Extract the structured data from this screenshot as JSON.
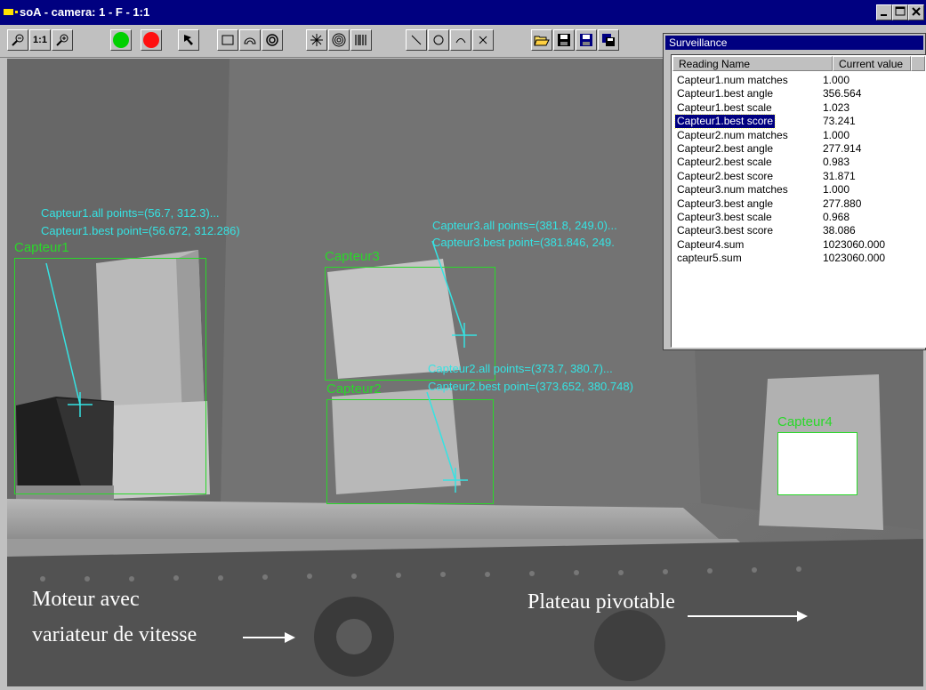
{
  "window": {
    "title": "soA - camera: 1 - F - 1:1",
    "controls": [
      "minimize-icon",
      "maximize-icon",
      "close-icon"
    ]
  },
  "toolbar": {
    "zoom_reset_label": "1:1",
    "icons": [
      "zoom-out-icon",
      "zoom-1to1-icon",
      "zoom-in-icon",
      "green-circle-icon",
      "red-circle-icon",
      "pointer-icon",
      "rectangle-icon",
      "arc-roi-icon",
      "ring-icon",
      "star-icon",
      "target-icon",
      "barcode-icon",
      "line-icon",
      "circle-icon",
      "arc-icon",
      "cross-icon",
      "open-folder-icon",
      "save-icon",
      "save-as-icon",
      "save-all-icon"
    ]
  },
  "overlays": {
    "c1_all": "Capteur1.all points=(56.7, 312.3)...",
    "c1_best": "Capteur1.best point=(56.672, 312.286)",
    "c1_label": "Capteur1",
    "c3_all": "Capteur3.all points=(381.8, 249.0)...",
    "c3_best": "Capteur3.best point=(381.846, 249.",
    "c3_label": "Capteur3",
    "c2_all": "Capteur2.all points=(373.7, 380.7)...",
    "c2_best": "Capteur2.best point=(373.652, 380.748)",
    "c2_label": "Capteur2",
    "c4_label": "Capteur4"
  },
  "annotations": {
    "motor_line1": "Moteur avec",
    "motor_line2": "variateur de vitesse",
    "plateau": "Plateau pivotable"
  },
  "surveillance": {
    "title": "Surveillance",
    "col_name": "Reading Name",
    "col_value": "Current value",
    "selected_index": 3,
    "rows": [
      {
        "name": "Capteur1.num matches",
        "value": "1.000"
      },
      {
        "name": "Capteur1.best angle",
        "value": "356.564"
      },
      {
        "name": "Capteur1.best scale",
        "value": "1.023"
      },
      {
        "name": "Capteur1.best score",
        "value": "73.241"
      },
      {
        "name": "Capteur2.num matches",
        "value": "1.000"
      },
      {
        "name": "Capteur2.best angle",
        "value": "277.914"
      },
      {
        "name": "Capteur2.best scale",
        "value": "0.983"
      },
      {
        "name": "Capteur2.best score",
        "value": "31.871"
      },
      {
        "name": "Capteur3.num matches",
        "value": "1.000"
      },
      {
        "name": "Capteur3.best angle",
        "value": "277.880"
      },
      {
        "name": "Capteur3.best scale",
        "value": "0.968"
      },
      {
        "name": "Capteur3.best score",
        "value": "38.086"
      },
      {
        "name": "Capteur4.sum",
        "value": "1023060.000"
      },
      {
        "name": "capteur5.sum",
        "value": "1023060.000"
      }
    ]
  },
  "colors": {
    "overlay_cyan": "#35e3e3",
    "roi_green": "#2ad82a",
    "titlebar": "#000080"
  }
}
